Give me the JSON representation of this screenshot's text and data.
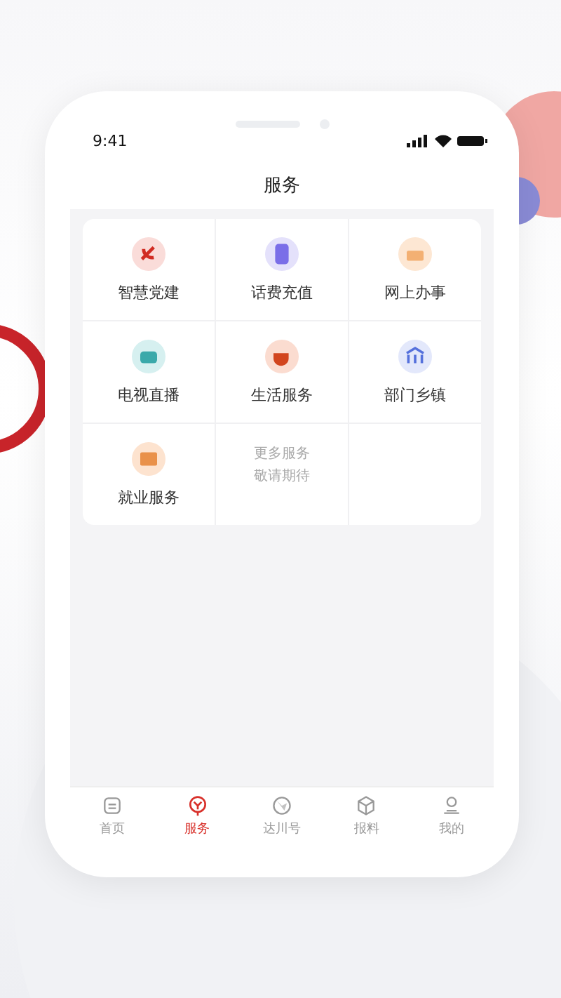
{
  "status_bar": {
    "time": "9:41"
  },
  "header": {
    "title": "服务"
  },
  "services": [
    {
      "label": "智慧党建"
    },
    {
      "label": "话费充值"
    },
    {
      "label": "网上办事"
    },
    {
      "label": "电视直播"
    },
    {
      "label": "生活服务"
    },
    {
      "label": "部门乡镇"
    },
    {
      "label": "就业服务"
    }
  ],
  "more": {
    "lines": [
      "更多服务",
      "敬请期待"
    ]
  },
  "tab_bar": [
    {
      "label": "首页",
      "selected": false
    },
    {
      "label": "服务",
      "selected": true
    },
    {
      "label": "达川号",
      "selected": false
    },
    {
      "label": "报料",
      "selected": false
    },
    {
      "label": "我的",
      "selected": false
    }
  ]
}
